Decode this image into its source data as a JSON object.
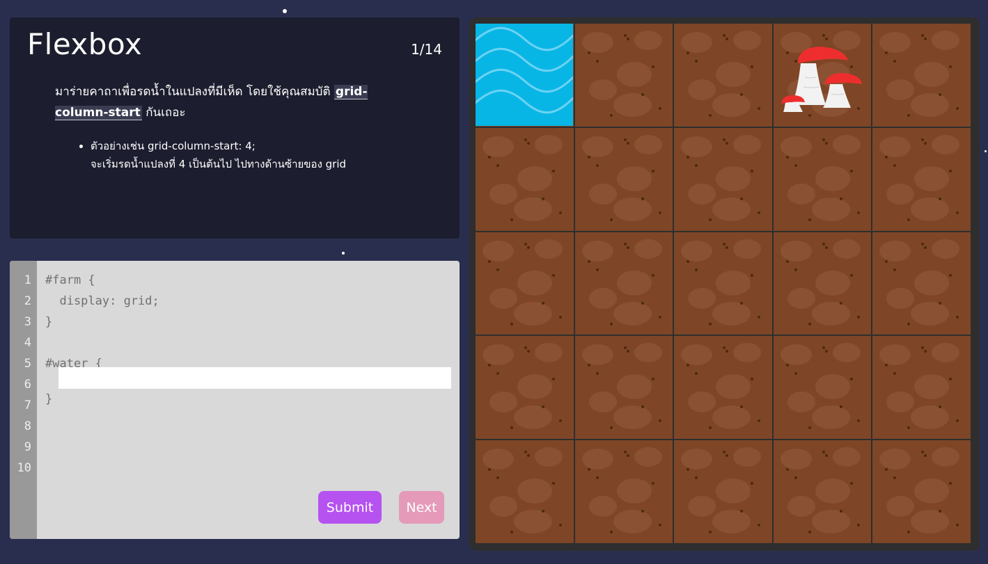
{
  "instructions": {
    "title": "Flexbox",
    "level": "1/14",
    "desc_before": "มาร่ายคาถาเพื่อรดน้ำในแปลงที่มีเห็ด โดยใช้คุณสมบัติ ",
    "desc_code": "grid-column-start",
    "desc_after": " กันเถอะ",
    "example_line1": "ตัวอย่างเช่น grid-column-start: 4;",
    "example_line2": "จะเริ่มรดน้ำแปลงที่ 4 เป็นต้นไป ไปทางด้านซ้ายของ grid"
  },
  "editor": {
    "line_numbers": [
      "1",
      "2",
      "3",
      "4",
      "5",
      "6",
      "7",
      "8",
      "9",
      "10"
    ],
    "line1": "#farm {",
    "line2": "  display: grid;",
    "line3": "}",
    "line5": "#water {",
    "line7": "}",
    "input_value": "",
    "submit_label": "Submit",
    "next_label": "Next"
  },
  "board": {
    "columns": 5,
    "rows": 5,
    "water_tile": {
      "row": 1,
      "column": 1
    },
    "mushroom_tile": {
      "row": 1,
      "column": 4
    }
  },
  "colors": {
    "background": "#2a2e4e",
    "panel": "#1c1d2e",
    "soil": "#7e4626",
    "water": "#08b6e6",
    "submit": "#b552f0",
    "next": "#e49ab8",
    "mushroom_cap": "#ee2e2e"
  },
  "icons": [
    "water-waves-icon",
    "mushroom-icon"
  ]
}
